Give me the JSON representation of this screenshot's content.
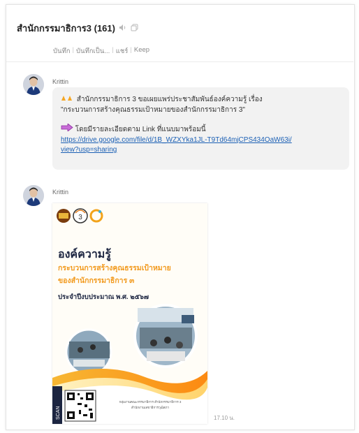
{
  "header": {
    "title": "สำนักกรรมาธิการ3 (161)"
  },
  "tabs": [
    "บันทึก",
    "บันทึกเป็น...",
    "แชร์",
    "Keep"
  ],
  "messages": [
    {
      "sender": "Krittin",
      "line1": "สำนักกรรมาธิการ 3 ขอเผยแพร่ประชาสัมพันธ์องค์ความรู้ เรื่อง",
      "line2": "\"กระบวนการสร้างคุณธรรมเป้าหมายของสำนักกรรมาธิการ 3\"",
      "line3": "โดยมีรายละเอียดตาม Link ที่แนบมาพร้อมนี้",
      "link1": "https://drive.google.com/file/d/1B_WZXYka1JL-T9Td64mjCPS434OaW63i/",
      "link2": "view?usp=sharing"
    },
    {
      "sender": "Krittin",
      "time": "17.10 น."
    }
  ],
  "poster": {
    "badge_number": "3",
    "title": "องค์ความรู้",
    "subtitle1": "กระบวนการสร้างคุณธรรมเป้าหมาย",
    "subtitle2": "ของสำนักกรรมาธิการ ๓",
    "fiscal": "ประจำปีงบประมาณ พ.ศ. ๒๕๖๗",
    "scan": "SCAN",
    "footer1": "กลุ่มงานคณะกรรมาธิการ สำนักกรรมาธิการ 3",
    "footer2": "สำนักงานเลขาธิการวุฒิสภา"
  },
  "colors": {
    "link": "#1a5fb4",
    "bubble": "#f2f2f2",
    "poster_orange": "#f29a1e",
    "poster_title": "#1c2541"
  },
  "icons": [
    "speaker-icon",
    "copy-icon",
    "hands-emoji-icon",
    "arrow-right-emoji-icon",
    "avatar-icon",
    "qr-code-icon"
  ]
}
